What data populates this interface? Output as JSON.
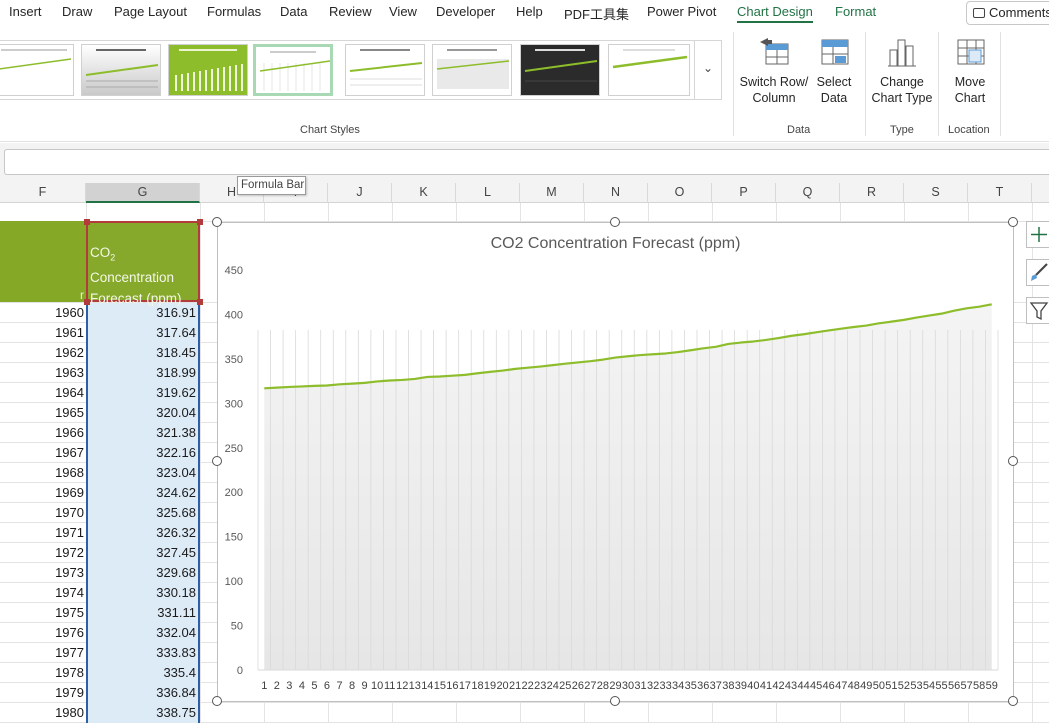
{
  "ribbon_tabs": [
    "Insert",
    "Draw",
    "Page Layout",
    "Formulas",
    "Data",
    "Review",
    "View",
    "Developer",
    "Help",
    "PDF工具集",
    "Power Pivot",
    "Chart Design",
    "Format"
  ],
  "active_tab": "Chart Design",
  "comments_label": "Comments",
  "gallery_group_label": "Chart Styles",
  "buttons": {
    "switch_row_col_1": "Switch Row/",
    "switch_row_col_2": "Column",
    "select_data_1": "Select",
    "select_data_2": "Data",
    "change_type_1": "Change",
    "change_type_2": "Chart Type",
    "move_chart_1": "Move",
    "move_chart_2": "Chart"
  },
  "group_labels": {
    "data": "Data",
    "type": "Type",
    "location": "Location"
  },
  "tooltip": "Formula Bar",
  "columns": [
    "F",
    "G",
    "H",
    "I",
    "J",
    "K",
    "L",
    "M",
    "N",
    "O",
    "P",
    "Q",
    "R",
    "S",
    "T"
  ],
  "header_f_partial": "r",
  "header_g": {
    "line1_main": "CO",
    "line1_sub": "2",
    "line2": "Concentration",
    "line3": "Forecast (ppm)"
  },
  "rows": [
    {
      "year": "1960",
      "value": "316.91"
    },
    {
      "year": "1961",
      "value": "317.64"
    },
    {
      "year": "1962",
      "value": "318.45"
    },
    {
      "year": "1963",
      "value": "318.99"
    },
    {
      "year": "1964",
      "value": "319.62"
    },
    {
      "year": "1965",
      "value": "320.04"
    },
    {
      "year": "1966",
      "value": "321.38"
    },
    {
      "year": "1967",
      "value": "322.16"
    },
    {
      "year": "1968",
      "value": "323.04"
    },
    {
      "year": "1969",
      "value": "324.62"
    },
    {
      "year": "1970",
      "value": "325.68"
    },
    {
      "year": "1971",
      "value": "326.32"
    },
    {
      "year": "1972",
      "value": "327.45"
    },
    {
      "year": "1973",
      "value": "329.68"
    },
    {
      "year": "1974",
      "value": "330.18"
    },
    {
      "year": "1975",
      "value": "331.11"
    },
    {
      "year": "1976",
      "value": "332.04"
    },
    {
      "year": "1977",
      "value": "333.83"
    },
    {
      "year": "1978",
      "value": "335.4"
    },
    {
      "year": "1979",
      "value": "336.84"
    },
    {
      "year": "1980",
      "value": "338.75"
    }
  ],
  "colors": {
    "accent": "#217346",
    "series": "#8dbd2b",
    "header_fill": "#86a82b",
    "selection_border": "#2e5fa6",
    "selection_fill": "#ddebf7"
  },
  "chart_data": {
    "type": "line",
    "title": "CO2 Concentration Forecast (ppm)",
    "xlabel": "",
    "ylabel": "",
    "ylim": [
      0,
      450
    ],
    "yticks": [
      0,
      50,
      100,
      150,
      200,
      250,
      300,
      350,
      400,
      450
    ],
    "gridlines": "vertical",
    "x": [
      1,
      2,
      3,
      4,
      5,
      6,
      7,
      8,
      9,
      10,
      11,
      12,
      13,
      14,
      15,
      16,
      17,
      18,
      19,
      20,
      21,
      22,
      23,
      24,
      25,
      26,
      27,
      28,
      29,
      30,
      31,
      32,
      33,
      34,
      35,
      36,
      37,
      38,
      39,
      40,
      41,
      42,
      43,
      44,
      45,
      46,
      47,
      48,
      49,
      50,
      51,
      52,
      53,
      54,
      55,
      56,
      57,
      58,
      59
    ],
    "series": [
      {
        "values": [
          316.91,
          317.64,
          318.45,
          318.99,
          319.62,
          320.04,
          321.38,
          322.16,
          323.04,
          324.62,
          325.68,
          326.32,
          327.45,
          329.68,
          330.18,
          331.11,
          332.04,
          333.83,
          335.4,
          336.84,
          338.75,
          340.1,
          341.4,
          343.0,
          344.6,
          346.0,
          347.4,
          349.2,
          351.5,
          353.0,
          354.3,
          355.2,
          356.1,
          357.7,
          359.7,
          361.9,
          363.6,
          366.8,
          368.4,
          369.6,
          371.3,
          373.4,
          375.9,
          377.7,
          379.9,
          382.0,
          384.0,
          385.9,
          387.5,
          390.0,
          391.9,
          393.9,
          396.5,
          398.7,
          400.9,
          404.2,
          406.9,
          408.7,
          411.4
        ]
      }
    ]
  }
}
